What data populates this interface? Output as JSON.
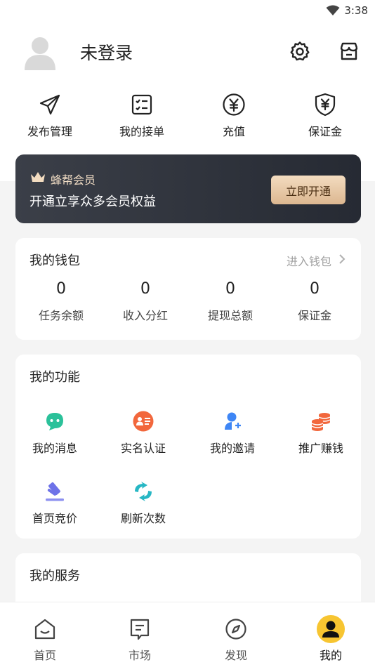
{
  "status_bar": {
    "time": "3:38",
    "icons": [
      "wifi-icon"
    ]
  },
  "profile": {
    "login_text": "未登录",
    "icons": [
      "avatar-icon",
      "gear-icon",
      "store-icon"
    ]
  },
  "quick_actions": [
    {
      "label": "发布管理",
      "icon": "send-icon"
    },
    {
      "label": "我的接单",
      "icon": "checklist-icon"
    },
    {
      "label": "充值",
      "icon": "yen-circle-icon"
    },
    {
      "label": "保证金",
      "icon": "yen-shield-icon"
    }
  ],
  "vip": {
    "title": "蜂帮会员",
    "subtitle": "开通立享众多会员权益",
    "button": "立即开通",
    "colors": {
      "bg": "#2b2f38",
      "title": "#f0dcc4",
      "button": "#e8c9a3"
    }
  },
  "wallet": {
    "title": "我的钱包",
    "link": "进入钱包",
    "stats": [
      {
        "value": "0",
        "label": "任务余额"
      },
      {
        "value": "0",
        "label": "收入分红"
      },
      {
        "value": "0",
        "label": "提现总额"
      },
      {
        "value": "0",
        "label": "保证金"
      }
    ]
  },
  "functions": {
    "title": "我的功能",
    "items": [
      {
        "label": "我的消息",
        "icon": "message-icon",
        "color": "#2bc19a"
      },
      {
        "label": "实名认证",
        "icon": "id-card-icon",
        "color": "#f2673c"
      },
      {
        "label": "我的邀请",
        "icon": "invite-user-icon",
        "color": "#3e86f5"
      },
      {
        "label": "推广赚钱",
        "icon": "coins-icon",
        "color": "#f2673c"
      },
      {
        "label": "首页竞价",
        "icon": "auction-hammer-icon",
        "color": "#6d72e8"
      },
      {
        "label": "刷新次数",
        "icon": "refresh-icon",
        "color": "#27b7c4"
      }
    ]
  },
  "services": {
    "title": "我的服务"
  },
  "bottom_nav": [
    {
      "label": "首页",
      "icon": "home-icon"
    },
    {
      "label": "市场",
      "icon": "market-icon"
    },
    {
      "label": "发现",
      "icon": "compass-icon"
    },
    {
      "label": "我的",
      "icon": "profile-icon",
      "active": true,
      "active_color": "#f7c531"
    }
  ]
}
